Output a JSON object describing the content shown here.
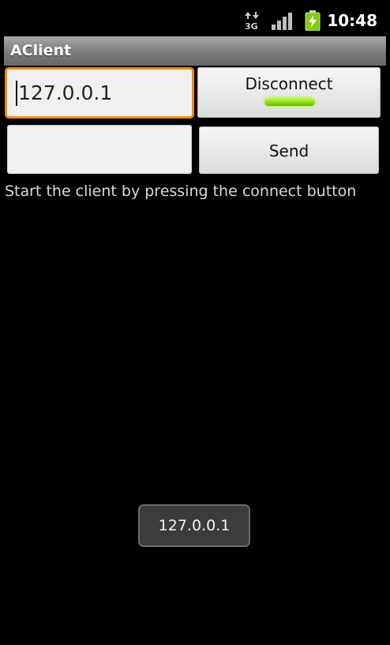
{
  "status_bar": {
    "time": "10:48",
    "network_label": "3G",
    "icons": [
      "network-3g-icon",
      "signal-icon",
      "battery-charging-icon"
    ],
    "colors": {
      "battery": "#7fd000"
    }
  },
  "app": {
    "title": "AClient"
  },
  "form": {
    "ip_value": "127.0.0.1",
    "message_value": "",
    "disconnect_label": "Disconnect",
    "send_label": "Send",
    "focus_color": "#f28c00",
    "led_color": "#7fd000"
  },
  "status_text": "Start the client by pressing the connect button",
  "toast": {
    "text": "127.0.0.1"
  }
}
